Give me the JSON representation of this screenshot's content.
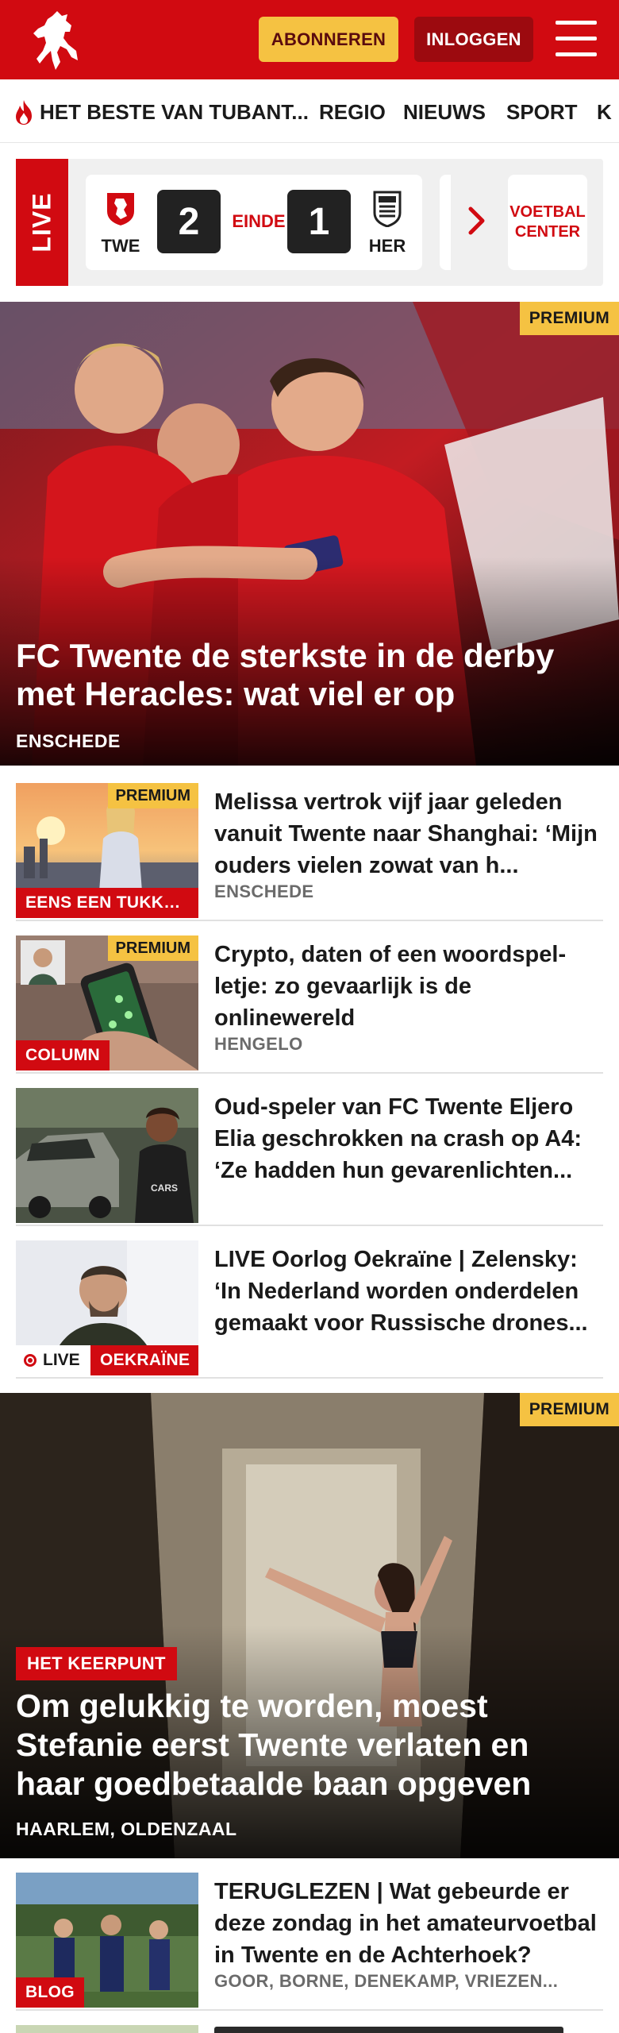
{
  "header": {
    "logo_alt": "Tubantia",
    "subscribe_label": "ABONNEREN",
    "login_label": "INLOGGEN",
    "colors": {
      "brand_red": "#d10a11",
      "accent_yellow": "#f5c242",
      "dark_red": "#9c0a0f"
    }
  },
  "nav": {
    "items": [
      {
        "label": "HET BESTE VAN TUBANT..."
      },
      {
        "label": "REGIO"
      },
      {
        "label": "NIEUWS"
      },
      {
        "label": "SPORT"
      },
      {
        "label": "K"
      }
    ]
  },
  "live": {
    "label": "LIVE",
    "home": {
      "abbr": "TWE",
      "score": "2"
    },
    "away": {
      "abbr": "HER",
      "score": "1"
    },
    "status": "EINDE",
    "center_label": "VOETBAL CENTER"
  },
  "hero": {
    "badge": "PREMIUM",
    "title": "FC Twente de sterkste in de derby met Heracles: wat viel er op",
    "location": "ENSCHEDE"
  },
  "articles": [
    {
      "badge": "PREMIUM",
      "kicker": "EENS EEN TUKKE...",
      "title": "Melissa vertrok vijf jaar geleden vanuit Twente naar Shanghai: ‘Mijn ouders vielen zowat van h...",
      "location": "ENSCHEDE"
    },
    {
      "badge": "PREMIUM",
      "kicker": "COLUMN",
      "title": "Crypto, daten of een woordspel­letje: zo gevaarlijk is de onlinewereld",
      "location": "HENGELO"
    },
    {
      "badge": "",
      "kicker": "",
      "title": "Oud-speler van FC Twente Eljero Elia geschrokken na crash op A4: ‘Ze hadden hun gevarenlichten...",
      "location": ""
    },
    {
      "badge": "",
      "live": "LIVE",
      "kicker": "OEKRAÏNE",
      "title": "LIVE Oorlog Oekraïne | Zelensky: ‘In Nederland worden onderdelen gemaakt voor Russische drones...",
      "location": ""
    }
  ],
  "feature": {
    "badge": "PREMIUM",
    "kicker": "HET KEERPUNT",
    "title": "Om gelukkig te worden, moest Stefanie eerst Twente verlaten en haar goedbetaalde baan opgeven",
    "location": "HAARLEM, OLDENZAAL"
  },
  "blog": {
    "kicker": "BLOG",
    "title": "TERUGLEZEN | Wat gebeurde er deze zondag in het amateurvoet­bal in Twente en de Achterhoek?",
    "location": "GOOR, BORNE, DENEKAMP, VRIEZEN..."
  }
}
